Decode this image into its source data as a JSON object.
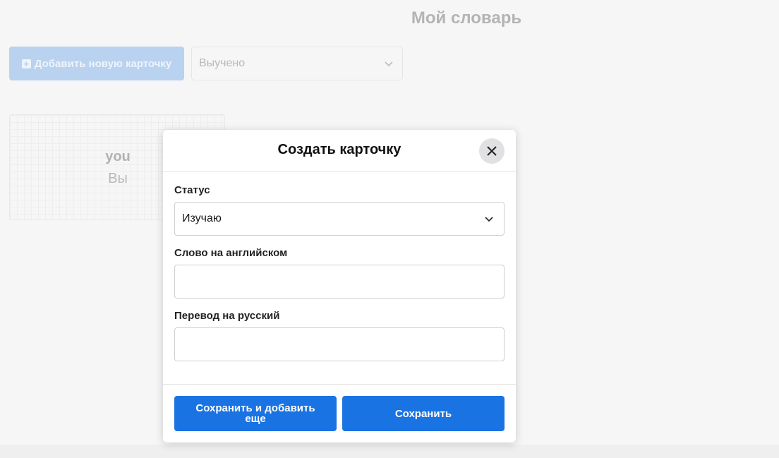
{
  "page": {
    "title": "Мой словарь"
  },
  "toolbar": {
    "add_button_label": "Добавить новую карточку",
    "filter_value": "Выучено",
    "add_icon": "plus-square-icon",
    "filter_icon": "chevron-down-icon"
  },
  "cards": [
    {
      "word": "you",
      "translation": "Вы"
    }
  ],
  "modal": {
    "title": "Создать карточку",
    "close_icon": "close-icon",
    "status_label": "Статус",
    "status_value": "Изучаю",
    "english_label": "Слово на английском",
    "english_value": "",
    "russian_label": "Перевод на русский",
    "russian_value": "",
    "save_and_add_label": "Сохранить и добавить еще",
    "save_label": "Сохранить"
  },
  "colors": {
    "primary": "#1a73e3",
    "background": "#f6f6f6",
    "overlay_button": "#b9d2ef"
  }
}
